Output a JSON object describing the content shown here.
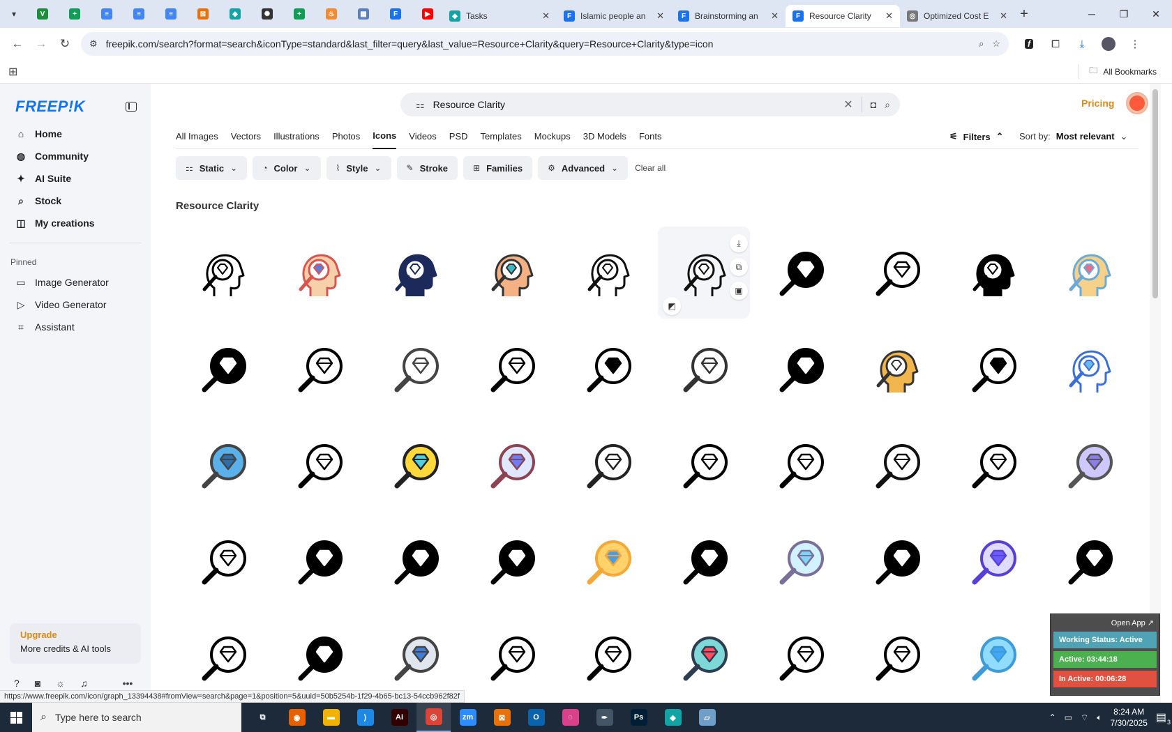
{
  "browser": {
    "pinned_tabs": [
      {
        "name": "vpn",
        "color": "#1e8e3e",
        "glyph": "V"
      },
      {
        "name": "sheets",
        "color": "#0f9d58",
        "glyph": "+"
      },
      {
        "name": "docs1",
        "color": "#4285f4",
        "glyph": "≡"
      },
      {
        "name": "docs2",
        "color": "#4285f4",
        "glyph": "≡"
      },
      {
        "name": "docs3",
        "color": "#4285f4",
        "glyph": "≡"
      },
      {
        "name": "app-orange",
        "color": "#e8710a",
        "glyph": "⊠"
      },
      {
        "name": "app-teal",
        "color": "#12a4a4",
        "glyph": "◆"
      },
      {
        "name": "openai",
        "color": "#333333",
        "glyph": "✺"
      },
      {
        "name": "sheets2",
        "color": "#0f9d58",
        "glyph": "+"
      },
      {
        "name": "app-flame",
        "color": "#f28b30",
        "glyph": "♨"
      },
      {
        "name": "app-grid",
        "color": "#5a7fbf",
        "glyph": "▦"
      },
      {
        "name": "forms",
        "color": "#1a73e8",
        "glyph": "F"
      },
      {
        "name": "youtube",
        "color": "#ff0000",
        "glyph": "▶"
      }
    ],
    "tabs": [
      {
        "title": "Tasks",
        "color": "#12a4a4",
        "glyph": "◆",
        "active": false
      },
      {
        "title": "Islamic people an",
        "color": "#1a73e8",
        "glyph": "F",
        "active": false
      },
      {
        "title": "Brainstorming an",
        "color": "#1a73e8",
        "glyph": "F",
        "active": false
      },
      {
        "title": "Resource Clarity",
        "color": "#1a73e8",
        "glyph": "F",
        "active": true
      },
      {
        "title": "Optimized Cost E",
        "color": "#777777",
        "glyph": "◎",
        "active": false
      }
    ],
    "new_tab": "+",
    "url": "freepik.com/search?format=search&iconType=standard&last_filter=query&last_value=Resource+Clarity&query=Resource+Clarity&type=icon",
    "all_bookmarks": "All Bookmarks"
  },
  "sidebar": {
    "logo": "FREEP!K",
    "nav": [
      {
        "label": "Home",
        "icon": "⌂"
      },
      {
        "label": "Community",
        "icon": "◍"
      },
      {
        "label": "AI Suite",
        "icon": "✦"
      },
      {
        "label": "Stock",
        "icon": "⌕"
      },
      {
        "label": "My creations",
        "icon": "◫"
      }
    ],
    "pinned_label": "Pinned",
    "pinned": [
      {
        "label": "Image Generator",
        "icon": "▭"
      },
      {
        "label": "Video Generator",
        "icon": "▷"
      },
      {
        "label": "Assistant",
        "icon": "⌗"
      }
    ],
    "upgrade_title": "Upgrade",
    "upgrade_sub": "More credits & AI tools"
  },
  "search": {
    "value": "Resource Clarity",
    "clear": "✕"
  },
  "header": {
    "pricing": "Pricing"
  },
  "type_tabs": [
    "All Images",
    "Vectors",
    "Illustrations",
    "Photos",
    "Icons",
    "Videos",
    "PSD",
    "Templates",
    "Mockups",
    "3D Models",
    "Fonts"
  ],
  "active_type_tab": "Icons",
  "filters_label": "Filters",
  "sort_label": "Sort by:",
  "sort_value": "Most relevant",
  "chips": [
    {
      "label": "Static",
      "icon": "⚏",
      "dropdown": true
    },
    {
      "label": "Color",
      "icon": "◔",
      "dropdown": true
    },
    {
      "label": "Style",
      "icon": "⌇",
      "dropdown": true
    },
    {
      "label": "Stroke",
      "icon": "✎",
      "dropdown": false
    },
    {
      "label": "Families",
      "icon": "⊞",
      "dropdown": false
    },
    {
      "label": "Advanced",
      "icon": "⚙",
      "dropdown": true
    }
  ],
  "clear_all": "Clear all",
  "section_title": "Resource Clarity",
  "status_url": "https://www.freepik.com/icon/graph_13394438#fromView=search&page=1&position=5&uuid=50b5254b-1f29-4b65-bc13-54ccb962f82f",
  "tracker": {
    "open_app": "Open App ↗",
    "working": "Working Status: Active",
    "active": "Active: 03:44:18",
    "inactive": "In Active: 00:06:28",
    "colors": {
      "working": "#4fa3b4",
      "active": "#4caf50",
      "inactive": "#e0523f"
    }
  },
  "taskbar": {
    "search_placeholder": "Type here to search",
    "time": "8:24 AM",
    "date": "7/30/2025",
    "notifications": "3",
    "apps": [
      {
        "name": "task-view",
        "color": "transparent",
        "glyph": "⧉"
      },
      {
        "name": "firefox",
        "color": "#e66000",
        "glyph": "◉"
      },
      {
        "name": "file-explorer",
        "color": "#f0b400",
        "glyph": "▬"
      },
      {
        "name": "vscode",
        "color": "#1e88e5",
        "glyph": "⟩"
      },
      {
        "name": "illustrator",
        "color": "#330000",
        "glyph": "Ai"
      },
      {
        "name": "chrome",
        "color": "#db4437",
        "glyph": "◎"
      },
      {
        "name": "zoom",
        "color": "#2d8cff",
        "glyph": "zm"
      },
      {
        "name": "app-orange",
        "color": "#e8710a",
        "glyph": "⊠"
      },
      {
        "name": "outlook",
        "color": "#0a64ad",
        "glyph": "O"
      },
      {
        "name": "creative-cloud",
        "color": "#d9418d",
        "glyph": "◌"
      },
      {
        "name": "pen-app",
        "color": "#445566",
        "glyph": "✒"
      },
      {
        "name": "photoshop",
        "color": "#001e36",
        "glyph": "Ps"
      },
      {
        "name": "app-teal",
        "color": "#12a4a4",
        "glyph": "◆"
      },
      {
        "name": "notes-app",
        "color": "#6f9fc8",
        "glyph": "▱"
      }
    ]
  }
}
